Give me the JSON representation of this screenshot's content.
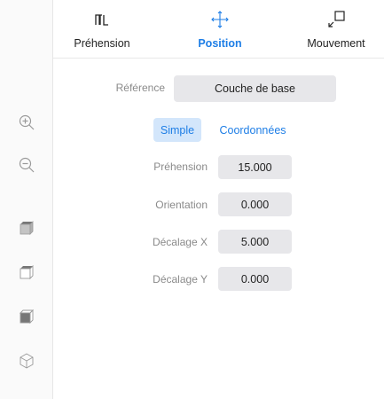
{
  "tabs": [
    {
      "label": "Préhension",
      "icon": "gripper-icon"
    },
    {
      "label": "Position",
      "icon": "move-arrows-icon",
      "active": true
    },
    {
      "label": "Mouvement",
      "icon": "motion-icon"
    }
  ],
  "reference": {
    "label": "Référence",
    "value": "Couche de base"
  },
  "modes": {
    "simple": "Simple",
    "coords": "Coordonnées"
  },
  "fields": [
    {
      "label": "Préhension",
      "value": "15.000"
    },
    {
      "label": "Orientation",
      "value": "0.000"
    },
    {
      "label": "Décalage X",
      "value": "5.000"
    },
    {
      "label": "Décalage Y",
      "value": "0.000"
    }
  ],
  "sidebar": [
    "zoom-in-icon",
    "zoom-out-icon",
    "view-top-icon",
    "view-front-icon",
    "view-side-icon",
    "view-3d-icon"
  ],
  "colors": {
    "accent": "#1e7ee6",
    "field_bg": "#e7e7ea",
    "selected_bg": "#d3e6fb",
    "icon": "#9a9a9a"
  }
}
